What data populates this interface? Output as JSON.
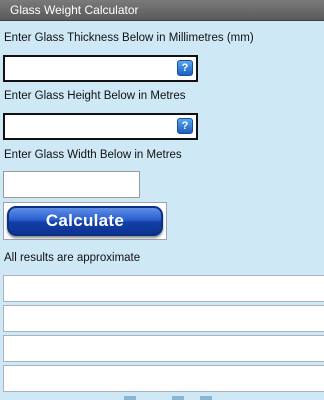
{
  "app": {
    "title": "Glass Weight Calculator"
  },
  "form": {
    "thickness": {
      "label": "Enter Glass Thickness Below in Millimetres (mm)",
      "value": "",
      "help_icon": "help-icon"
    },
    "height": {
      "label": "Enter Glass Height Below in Metres",
      "value": "",
      "help_icon": "help-icon"
    },
    "width": {
      "label": "Enter Glass Width Below in Metres",
      "value": ""
    }
  },
  "actions": {
    "calculate_label": "Calculate"
  },
  "results": {
    "note": "All results are approximate",
    "rows": [
      "",
      "",
      "",
      ""
    ]
  },
  "colors": {
    "page_background": "#cfe8f6",
    "titlebar": "#6a6a6a",
    "button": "#1e4fc0"
  }
}
